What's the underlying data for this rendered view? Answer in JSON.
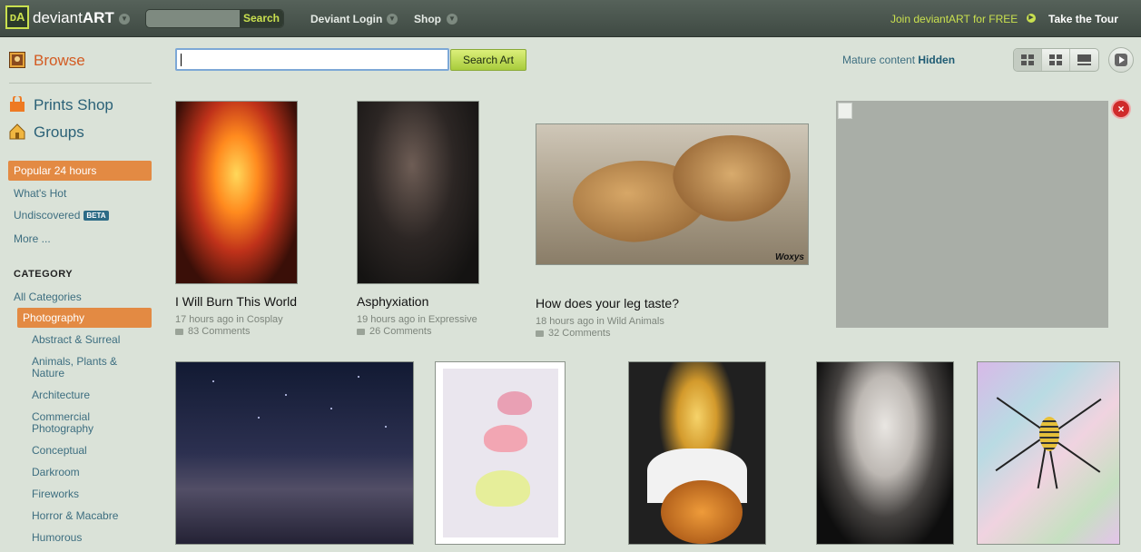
{
  "topbar": {
    "logo_text_a": "deviant",
    "logo_text_b": "ART",
    "search_placeholder": "",
    "search_button": "Search",
    "deviant_login": "Deviant Login",
    "shop": "Shop",
    "join": "Join deviantART for FREE",
    "tour": "Take the Tour"
  },
  "sidebar": {
    "browse": "Browse",
    "prints_shop": "Prints Shop",
    "groups": "Groups",
    "popular": "Popular 24 hours",
    "whats_hot": "What's Hot",
    "undiscovered": "Undiscovered",
    "beta": "BETA",
    "more": "More ...",
    "category_heading": "CATEGORY",
    "all_categories": "All Categories",
    "photography": "Photography",
    "subcategories": [
      "Abstract & Surreal",
      "Animals, Plants & Nature",
      "Architecture",
      "Commercial Photography",
      "Conceptual",
      "Darkroom",
      "Fireworks",
      "Horror & Macabre",
      "Humorous"
    ]
  },
  "searchrow": {
    "input_value": "",
    "button": "Search Art",
    "mature_label": "Mature content",
    "mature_state": "Hidden"
  },
  "deviations": [
    {
      "title": "I Will Burn This World",
      "time": "17 hours ago in",
      "category": "Cosplay",
      "comments": "83 Comments"
    },
    {
      "title": "Asphyxiation",
      "time": "19 hours ago in",
      "category": "Expressive",
      "comments": "26 Comments"
    },
    {
      "title": "How does your leg taste?",
      "time": "18 hours ago in",
      "category": "Wild Animals",
      "comments": "32 Comments",
      "watermark": "Woxys"
    }
  ],
  "ad": {
    "close": "×"
  },
  "icons": {
    "logo": "deviantart-logo-icon",
    "browse": "browse-icon",
    "prints": "shopping-bag-icon",
    "groups": "house-icon",
    "view_grid": "grid-view-icon",
    "view_list": "large-view-icon",
    "slideshow": "play-icon"
  },
  "colors": {
    "accent": "#e38a43",
    "link": "#3d6e80",
    "brand_green": "#c9e04f",
    "background": "#dae2d8"
  }
}
